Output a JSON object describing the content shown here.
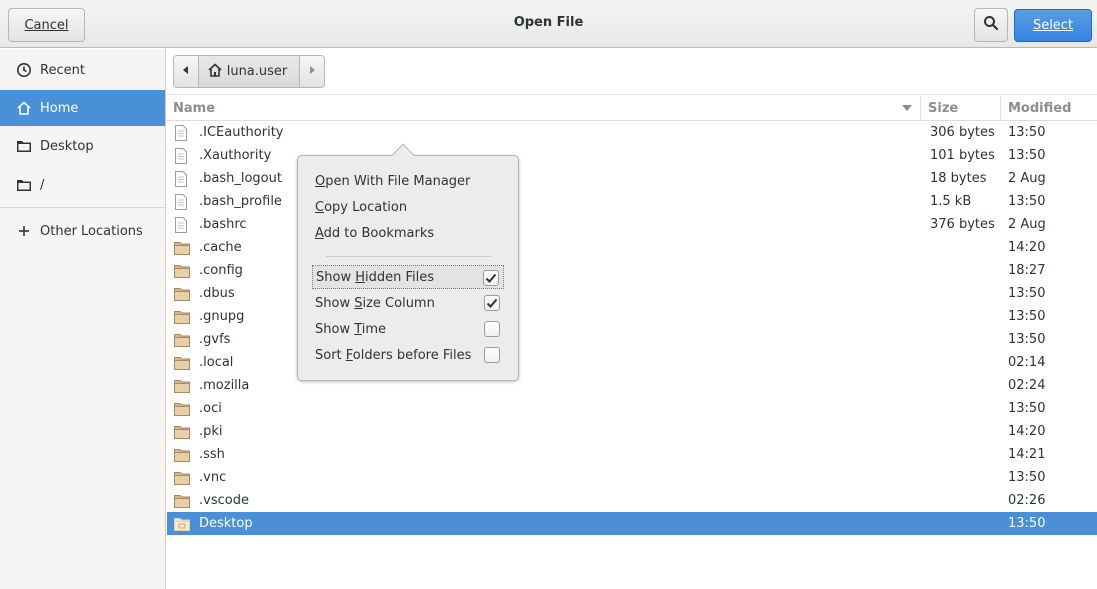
{
  "header": {
    "title": "Open File",
    "cancel_label": "Cancel",
    "select_label": "Select"
  },
  "sidebar": {
    "items": [
      {
        "label": "Recent",
        "icon": "clock-icon"
      },
      {
        "label": "Home",
        "icon": "home-icon",
        "selected": true
      },
      {
        "label": "Desktop",
        "icon": "folder-icon"
      },
      {
        "label": "/",
        "icon": "drive-icon"
      },
      {
        "label": "Other Locations",
        "icon": "plus-icon"
      }
    ]
  },
  "pathbar": {
    "current": "luna.user"
  },
  "columns": {
    "name": "Name",
    "size": "Size",
    "modified": "Modified"
  },
  "files": [
    {
      "name": ".ICEauthority",
      "size": "306 bytes",
      "modified": "13:50",
      "type": "file"
    },
    {
      "name": ".Xauthority",
      "size": "101 bytes",
      "modified": "13:50",
      "type": "file"
    },
    {
      "name": ".bash_logout",
      "size": "18 bytes",
      "modified": "2 Aug",
      "type": "file"
    },
    {
      "name": ".bash_profile",
      "size": "1.5 kB",
      "modified": "13:50",
      "type": "file"
    },
    {
      "name": ".bashrc",
      "size": "376 bytes",
      "modified": "2 Aug",
      "type": "file"
    },
    {
      "name": ".cache",
      "size": "",
      "modified": "14:20",
      "type": "folder"
    },
    {
      "name": ".config",
      "size": "",
      "modified": "18:27",
      "type": "folder"
    },
    {
      "name": ".dbus",
      "size": "",
      "modified": "13:50",
      "type": "folder"
    },
    {
      "name": ".gnupg",
      "size": "",
      "modified": "13:50",
      "type": "folder"
    },
    {
      "name": ".gvfs",
      "size": "",
      "modified": "13:50",
      "type": "folder"
    },
    {
      "name": ".local",
      "size": "",
      "modified": "02:14",
      "type": "folder"
    },
    {
      "name": ".mozilla",
      "size": "",
      "modified": "02:24",
      "type": "folder"
    },
    {
      "name": ".oci",
      "size": "",
      "modified": "13:50",
      "type": "folder"
    },
    {
      "name": ".pki",
      "size": "",
      "modified": "14:20",
      "type": "folder"
    },
    {
      "name": ".ssh",
      "size": "",
      "modified": "14:21",
      "type": "folder"
    },
    {
      "name": ".vnc",
      "size": "",
      "modified": "13:50",
      "type": "folder"
    },
    {
      "name": ".vscode",
      "size": "",
      "modified": "02:26",
      "type": "folder"
    },
    {
      "name": "Desktop",
      "size": "",
      "modified": "13:50",
      "type": "desktop-folder",
      "selected": true
    }
  ],
  "context_menu": {
    "actions": [
      {
        "label": "Open With File Manager"
      },
      {
        "label": "Copy Location"
      },
      {
        "label": "Add to Bookmarks"
      }
    ],
    "toggles": [
      {
        "label": "Show Hidden Files",
        "checked": true
      },
      {
        "label": "Show Size Column",
        "checked": true
      },
      {
        "label": "Show Time",
        "checked": false
      },
      {
        "label": "Sort Folders before Files",
        "checked": false
      }
    ]
  },
  "colors": {
    "accent": "#4a90d9",
    "select_button": "#3584e4",
    "folder": "#d9b98a"
  }
}
